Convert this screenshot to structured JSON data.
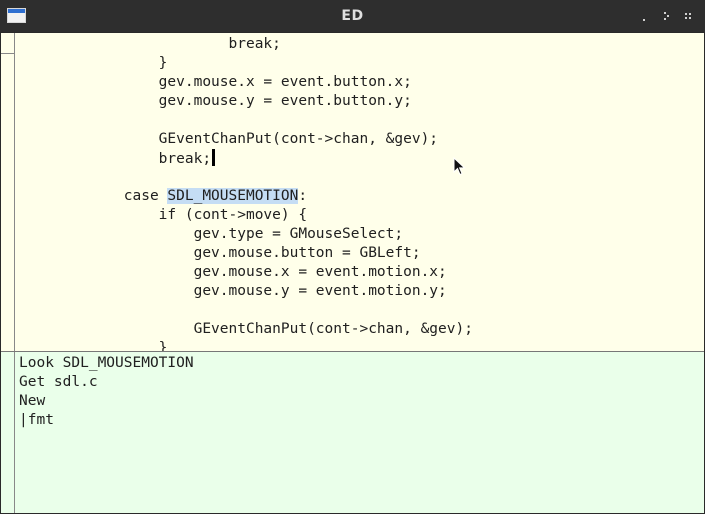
{
  "window": {
    "title": "ED",
    "controls": [
      "minimize-icon",
      "restore-icon",
      "close-icon"
    ]
  },
  "editor": {
    "lines": [
      {
        "text": "                        break;"
      },
      {
        "text": "                }"
      },
      {
        "text": "                gev.mouse.x = event.button.x;"
      },
      {
        "text": "                gev.mouse.y = event.button.y;"
      },
      {
        "text": ""
      },
      {
        "text": "                GEventChanPut(cont->chan, &gev);"
      },
      {
        "text": "                break;",
        "caret": true
      },
      {
        "text": ""
      },
      {
        "pre": "            case ",
        "hl": "SDL_MOUSEMOTION",
        "post": ":"
      },
      {
        "text": "                if (cont->move) {"
      },
      {
        "text": "                    gev.type = GMouseSelect;"
      },
      {
        "text": "                    gev.mouse.button = GBLeft;"
      },
      {
        "text": "                    gev.mouse.x = event.motion.x;"
      },
      {
        "text": "                    gev.mouse.y = event.motion.y;"
      },
      {
        "text": ""
      },
      {
        "text": "                    GEventChanPut(cont->chan, &gev);"
      },
      {
        "text": "                }"
      }
    ]
  },
  "command": {
    "lines": [
      "Look SDL_MOUSEMOTION",
      "Get sdl.c",
      "New",
      "|fmt"
    ]
  },
  "colors": {
    "editor_bg": "#ffffea",
    "command_bg": "#eaffea",
    "selection": "#c5ddf4",
    "titlebar": "#2e2e2e"
  }
}
